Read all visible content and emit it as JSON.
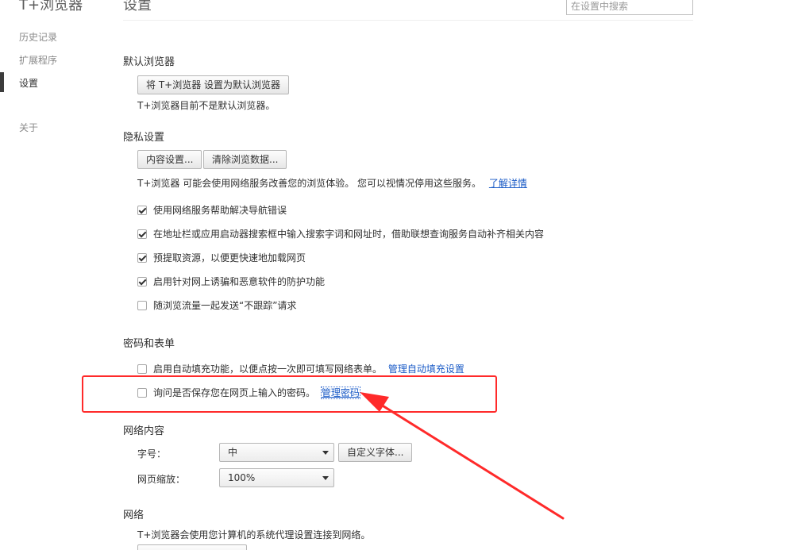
{
  "nav": {
    "app_title": "T+浏览器",
    "items": [
      {
        "label": "历史记录"
      },
      {
        "label": "扩展程序"
      },
      {
        "label": "设置"
      },
      {
        "label": "关于"
      }
    ]
  },
  "header": {
    "title": "设置",
    "hint": "",
    "search_placeholder": "在设置中搜索"
  },
  "default_browser": {
    "title": "默认浏览器",
    "button": "将 T+浏览器 设置为默认浏览器",
    "status": "T+浏览器目前不是默认浏览器。"
  },
  "privacy": {
    "title": "隐私设置",
    "content_settings_button": "内容设置...",
    "clear_data_button": "清除浏览数据...",
    "description": "T+浏览器 可能会使用网络服务改善您的浏览体验。 您可以视情况停用这些服务。",
    "learn_more": "了解详情",
    "options": [
      {
        "label": "使用网络服务帮助解决导航错误",
        "checked": true
      },
      {
        "label": "在地址栏或应用启动器搜索框中输入搜索字词和网址时，借助联想查询服务自动补齐相关内容",
        "checked": true
      },
      {
        "label": "预提取资源，以便更快速地加载网页",
        "checked": true
      },
      {
        "label": "启用针对网上诱骗和恶意软件的防护功能",
        "checked": true
      },
      {
        "label": "随浏览流量一起发送“不跟踪”请求",
        "checked": false
      }
    ]
  },
  "passwords": {
    "title": "密码和表单",
    "autofill_label": "启用自动填充功能，以便点按一次即可填写网络表单。",
    "autofill_link": "管理自动填充设置",
    "autofill_checked": false,
    "save_label": "询问是否保存您在网页上输入的密码。",
    "save_link": "管理密码",
    "save_checked": false
  },
  "web_content": {
    "title": "网络内容",
    "font_size_label": "字号：",
    "font_size_value": "中",
    "custom_font_button": "自定义字体...",
    "zoom_label": "网页缩放：",
    "zoom_value": "100%"
  },
  "network": {
    "title": "网络",
    "description": "T+浏览器会使用您计算机的系统代理设置连接到网络。",
    "proxy_button": ""
  },
  "colors": {
    "annotation": "#ff2a2a",
    "link": "#1a5bc7"
  }
}
